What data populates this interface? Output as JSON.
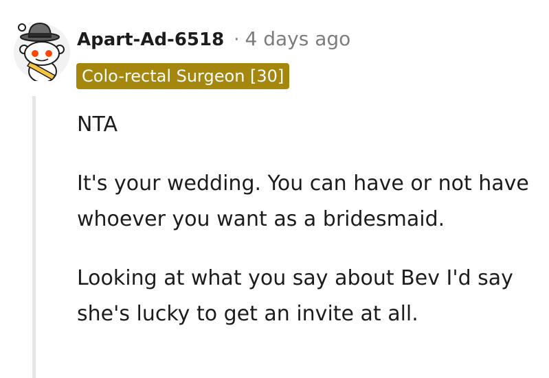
{
  "comment": {
    "author": "Apart-Ad-6518",
    "separator": "·",
    "timestamp": "4 days ago",
    "flair": "Colo-rectal Surgeon [30]",
    "paragraphs": [
      "NTA",
      "It's your wedding. You can have or not have whoever you want as a bridesmaid.",
      "Looking at what you say about Bev I'd say she's lucky to get an invite at all."
    ]
  },
  "icons": {
    "avatar": "snoo-avatar-fedora-icon"
  },
  "colors": {
    "flair_background": "#a4870c",
    "flair_text": "#ffffff",
    "meta_text": "#7c7c7c",
    "thread_line": "#e6e6e6",
    "snoo_eyes": "#ff4500"
  }
}
